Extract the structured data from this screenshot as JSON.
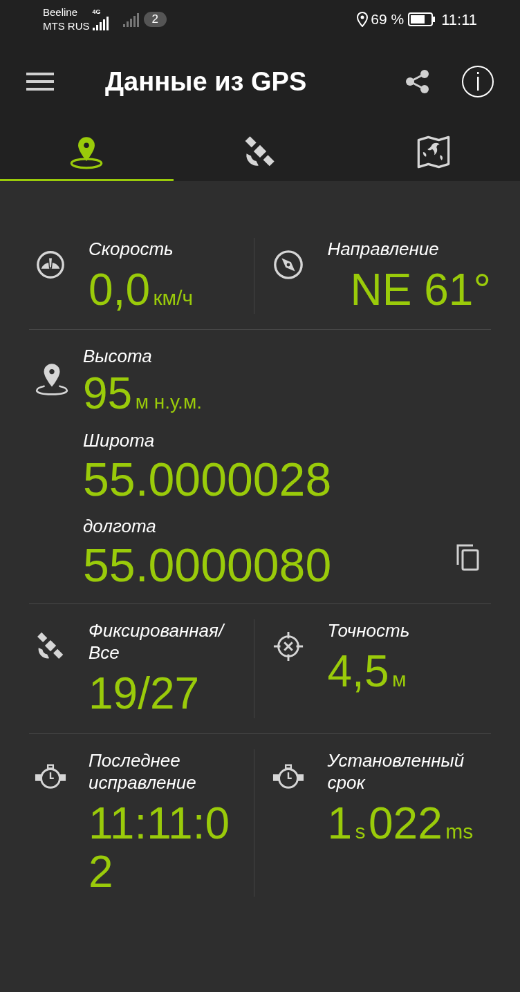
{
  "status_bar": {
    "carrier_1": "Beeline",
    "carrier_2": "MTS RUS",
    "network": "4G",
    "sim_badge": "2",
    "battery": "69 %",
    "time": "11:11"
  },
  "app_bar": {
    "title": "Данные из GPS"
  },
  "tabs": [
    {
      "kind": "location",
      "selected": true
    },
    {
      "kind": "satellite",
      "selected": false
    },
    {
      "kind": "map",
      "selected": false
    }
  ],
  "rows": [
    {
      "kind": "pair",
      "cells": [
        {
          "kind": "speedometer",
          "label_lines": [
            "Скорость"
          ],
          "parts": [
            {
              "kind": "value",
              "text": "0,0"
            },
            {
              "kind": "unit",
              "text": "км/ч"
            }
          ]
        },
        {
          "kind": "compass",
          "label_lines": [
            "Направление"
          ],
          "parts": [
            {
              "kind": "value",
              "text": "NE 61°"
            }
          ]
        }
      ]
    },
    {
      "kind": "position",
      "fields": [
        {
          "kind": "measure",
          "label": "Высота",
          "parts": [
            {
              "kind": "value",
              "text": "95"
            },
            {
              "kind": "unit",
              "text": "м н.у.м."
            }
          ]
        },
        {
          "kind": "coordinate",
          "label": "Широта",
          "parts": [
            {
              "kind": "value",
              "text": "55.0000028"
            }
          ]
        },
        {
          "kind": "coordinate",
          "label": "долгота",
          "parts": [
            {
              "kind": "value",
              "text": "55.0000080"
            }
          ]
        }
      ]
    },
    {
      "kind": "pair",
      "cells": [
        {
          "kind": "satellite",
          "label_lines": [
            "Фиксированная/",
            "Все"
          ],
          "parts": [
            {
              "kind": "value",
              "text": "19/27"
            }
          ]
        },
        {
          "kind": "crosshair",
          "label_lines": [
            "Точность"
          ],
          "parts": [
            {
              "kind": "value",
              "text": "4,5"
            },
            {
              "kind": "unit",
              "text": "м"
            }
          ]
        }
      ]
    },
    {
      "kind": "pair",
      "cells": [
        {
          "kind": "stopwatch",
          "label_lines": [
            "Последнее",
            "исправление"
          ],
          "parts": [
            {
              "kind": "value",
              "text": "11:11:02"
            }
          ]
        },
        {
          "kind": "stopwatch",
          "label_lines": [
            "Установленный",
            "срок"
          ],
          "parts": [
            {
              "kind": "value",
              "text": "1"
            },
            {
              "kind": "unit",
              "text": "s"
            },
            {
              "kind": "value",
              "text": "022"
            },
            {
              "kind": "unit",
              "text": "ms"
            }
          ]
        }
      ]
    }
  ]
}
